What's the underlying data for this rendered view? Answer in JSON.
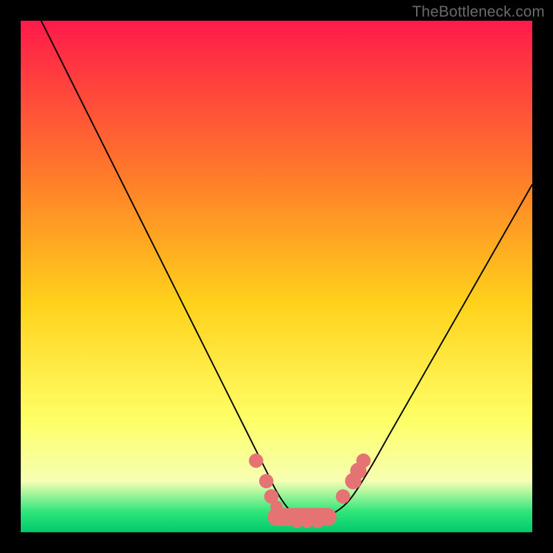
{
  "watermark": "TheBottleneck.com",
  "colors": {
    "bg_black": "#000000",
    "watermark_gray": "#6a6a6a",
    "curve_black": "#000000",
    "marker_fill": "#e57373",
    "grad_top": "#ff1a4b",
    "grad_mid_upper": "#ff7a2a",
    "grad_mid": "#ffd11a",
    "grad_mid_lower": "#ffff66",
    "grad_pale": "#f6ffb3",
    "grad_green": "#2fe67a",
    "grad_green_deep": "#00c96b"
  },
  "chart_data": {
    "type": "line",
    "title": "",
    "xlabel": "",
    "ylabel": "",
    "xlim": [
      0,
      100
    ],
    "ylim": [
      0,
      100
    ],
    "grid": false,
    "legend": false,
    "series": [
      {
        "name": "bottleneck-curve",
        "x": [
          4,
          8,
          12,
          16,
          20,
          24,
          28,
          32,
          36,
          40,
          44,
          48,
          50,
          52,
          54,
          56,
          58,
          60,
          64,
          68,
          72,
          76,
          80,
          84,
          88,
          92,
          96,
          100
        ],
        "y": [
          100,
          92,
          84,
          76,
          68,
          60,
          52,
          44,
          36,
          28,
          20,
          12,
          8,
          5,
          3,
          2,
          2,
          3,
          6,
          12,
          19,
          26,
          33,
          40,
          47,
          54,
          61,
          68
        ]
      }
    ],
    "markers": [
      {
        "x": 46,
        "y": 14,
        "r": 1.4
      },
      {
        "x": 48,
        "y": 10,
        "r": 1.4
      },
      {
        "x": 49,
        "y": 7,
        "r": 1.4
      },
      {
        "x": 50,
        "y": 5,
        "r": 1.2
      },
      {
        "x": 52,
        "y": 3,
        "r": 1.2
      },
      {
        "x": 54,
        "y": 2,
        "r": 1.2
      },
      {
        "x": 56,
        "y": 2,
        "r": 1.2
      },
      {
        "x": 58,
        "y": 2,
        "r": 1.2
      },
      {
        "x": 60,
        "y": 3,
        "r": 1.2
      },
      {
        "x": 63,
        "y": 7,
        "r": 1.4
      },
      {
        "x": 65,
        "y": 10,
        "r": 1.6
      },
      {
        "x": 66,
        "y": 12,
        "r": 1.6
      },
      {
        "x": 67,
        "y": 14,
        "r": 1.4
      }
    ],
    "marker_band": {
      "from_x": 50,
      "to_x": 60,
      "y": 3,
      "thickness": 3.5
    }
  }
}
